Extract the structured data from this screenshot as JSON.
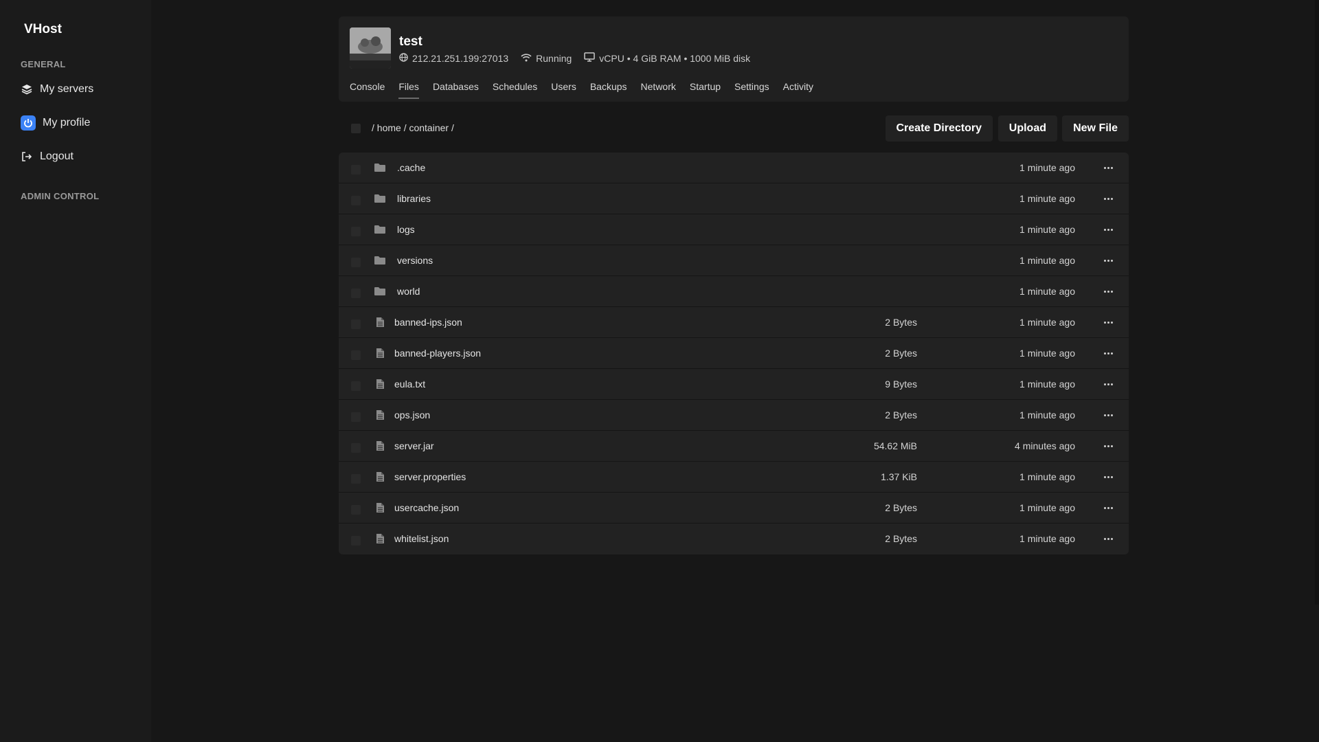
{
  "app": {
    "brand": "VHost"
  },
  "sidebar": {
    "general_label": "GENERAL",
    "admin_label": "ADMIN CONTROL",
    "items": [
      {
        "label": "My servers",
        "icon": "layers-icon"
      },
      {
        "label": "My profile",
        "icon": "power-icon"
      },
      {
        "label": "Logout",
        "icon": "logout-icon"
      }
    ]
  },
  "server": {
    "name": "test",
    "address": "212.21.251.199:27013",
    "status": "Running",
    "resources": "vCPU • 4 GiB RAM • 1000 MiB disk"
  },
  "tabs": [
    {
      "label": "Console",
      "active": false
    },
    {
      "label": "Files",
      "active": true
    },
    {
      "label": "Databases",
      "active": false
    },
    {
      "label": "Schedules",
      "active": false
    },
    {
      "label": "Users",
      "active": false
    },
    {
      "label": "Backups",
      "active": false
    },
    {
      "label": "Network",
      "active": false
    },
    {
      "label": "Startup",
      "active": false
    },
    {
      "label": "Settings",
      "active": false
    },
    {
      "label": "Activity",
      "active": false
    }
  ],
  "breadcrumb": {
    "text": "/ home / container /"
  },
  "toolbar": {
    "create_directory": "Create Directory",
    "upload": "Upload",
    "new_file": "New File"
  },
  "files": [
    {
      "name": ".cache",
      "type": "folder",
      "size": "",
      "modified": "1 minute ago"
    },
    {
      "name": "libraries",
      "type": "folder",
      "size": "",
      "modified": "1 minute ago"
    },
    {
      "name": "logs",
      "type": "folder",
      "size": "",
      "modified": "1 minute ago"
    },
    {
      "name": "versions",
      "type": "folder",
      "size": "",
      "modified": "1 minute ago"
    },
    {
      "name": "world",
      "type": "folder",
      "size": "",
      "modified": "1 minute ago"
    },
    {
      "name": "banned-ips.json",
      "type": "file",
      "size": "2 Bytes",
      "modified": "1 minute ago"
    },
    {
      "name": "banned-players.json",
      "type": "file",
      "size": "2 Bytes",
      "modified": "1 minute ago"
    },
    {
      "name": "eula.txt",
      "type": "file",
      "size": "9 Bytes",
      "modified": "1 minute ago"
    },
    {
      "name": "ops.json",
      "type": "file",
      "size": "2 Bytes",
      "modified": "1 minute ago"
    },
    {
      "name": "server.jar",
      "type": "file",
      "size": "54.62 MiB",
      "modified": "4 minutes ago"
    },
    {
      "name": "server.properties",
      "type": "file",
      "size": "1.37 KiB",
      "modified": "1 minute ago"
    },
    {
      "name": "usercache.json",
      "type": "file",
      "size": "2 Bytes",
      "modified": "1 minute ago"
    },
    {
      "name": "whitelist.json",
      "type": "file",
      "size": "2 Bytes",
      "modified": "1 minute ago"
    }
  ]
}
